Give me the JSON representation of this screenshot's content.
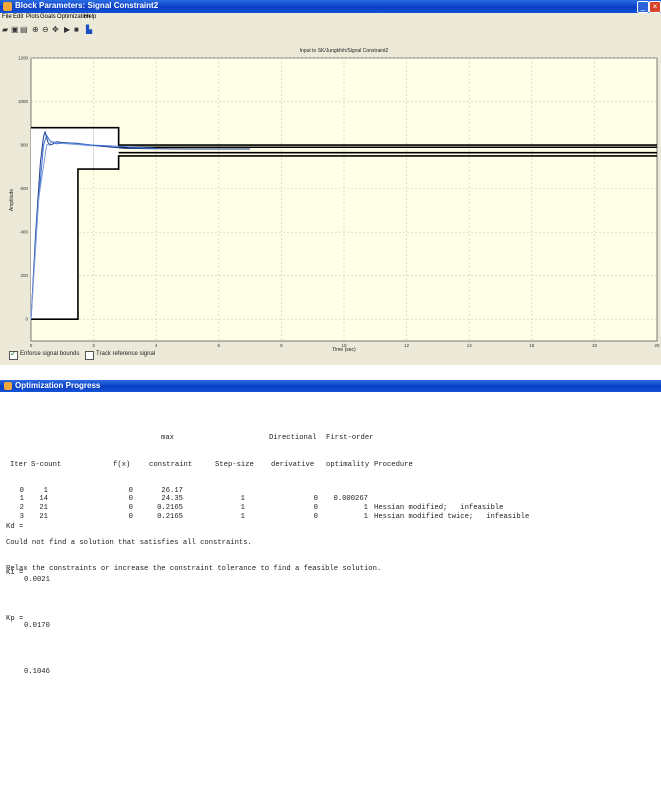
{
  "window1": {
    "title": "Block Parameters: Signal Constraint2",
    "menu": [
      "File",
      "Edit",
      "Plots",
      "Goals",
      "Optimization",
      "Help"
    ],
    "toolbar_icons": [
      "open-icon",
      "save-icon",
      "print-icon",
      "zoom-in-icon",
      "zoom-out-icon",
      "pan-icon",
      "start-icon",
      "stop-icon",
      "response-icon"
    ],
    "checkboxes": [
      {
        "label": "Enforce signal bounds",
        "checked": true
      },
      {
        "label": "Track reference signal",
        "checked": false
      }
    ]
  },
  "chart_data": {
    "type": "line",
    "title": "Input to SK/Jungkfoh/Signal Constraint2",
    "xlabel": "Time (sec)",
    "ylabel": "Amplitude",
    "xlim": [
      0,
      20
    ],
    "ylim": [
      -100,
      1200
    ],
    "x_ticks": [
      0,
      2,
      4,
      6,
      8,
      10,
      12,
      14,
      16,
      18,
      20
    ],
    "y_ticks": [
      0,
      200,
      400,
      600,
      800,
      1000,
      1200
    ],
    "bounds": [
      {
        "name": "upper",
        "points": [
          [
            0,
            880
          ],
          [
            2.8,
            880
          ],
          [
            2.8,
            800
          ],
          [
            20,
            800
          ]
        ]
      },
      {
        "name": "lower",
        "points": [
          [
            0,
            0
          ],
          [
            1.5,
            0
          ],
          [
            1.5,
            690
          ],
          [
            2.8,
            690
          ],
          [
            2.8,
            750
          ],
          [
            20,
            750
          ]
        ]
      },
      {
        "name": "reference-upper",
        "points": [
          [
            2.8,
            790
          ],
          [
            20,
            790
          ]
        ]
      },
      {
        "name": "reference-lower",
        "points": [
          [
            2.8,
            765
          ],
          [
            20,
            765
          ]
        ]
      }
    ],
    "series": [
      {
        "values_x": [
          0,
          0.15,
          0.3,
          0.4,
          0.45,
          0.5,
          0.55,
          0.6,
          0.7,
          0.8,
          1.0,
          1.5,
          2.0,
          3.0,
          4.0,
          5.0,
          6.0,
          7.0
        ],
        "values_y": [
          0,
          400,
          720,
          840,
          860,
          835,
          810,
          800,
          805,
          815,
          812,
          808,
          798,
          785,
          783,
          782,
          782,
          782
        ]
      },
      {
        "values_x": [
          0,
          0.2,
          0.4,
          0.5,
          0.6,
          0.8,
          1.2,
          2.0,
          4.0
        ],
        "values_y": [
          0,
          480,
          800,
          845,
          820,
          806,
          810,
          800,
          785
        ]
      },
      {
        "values_x": [
          0,
          0.25,
          0.5,
          0.7,
          1.0,
          2.0
        ],
        "values_y": [
          0,
          560,
          800,
          815,
          808,
          796
        ]
      }
    ]
  },
  "window2": {
    "title": "Optimization Progress",
    "table": {
      "header1": [
        "",
        "",
        "",
        "max",
        "",
        "Directional",
        "First-order",
        ""
      ],
      "header2": [
        "Iter",
        "S-count",
        "f(x)",
        "constraint",
        "Step-size",
        "derivative",
        "optimality",
        "Procedure"
      ],
      "rows": [
        [
          "0",
          "1",
          "0",
          "26.17",
          "",
          "",
          "",
          ""
        ],
        [
          "1",
          "14",
          "0",
          "24.35",
          "1",
          "0",
          "0.000267",
          ""
        ],
        [
          "2",
          "21",
          "0",
          "0.2165",
          "1",
          "0",
          "1",
          "Hessian modified;   infeasible"
        ],
        [
          "3",
          "21",
          "0",
          "0.2165",
          "1",
          "0",
          "1",
          "Hessian modified twice;   infeasible"
        ]
      ]
    },
    "messages": [
      "Could not find a solution that satisfies all constraints.",
      "Relax the constraints or increase the constraint tolerance to find a feasible solution."
    ],
    "results": [
      {
        "name": "Kd =",
        "value": "0.0021"
      },
      {
        "name": "Ki =",
        "value": "0.0170"
      },
      {
        "name": "Kp =",
        "value": "0.1046"
      }
    ]
  }
}
